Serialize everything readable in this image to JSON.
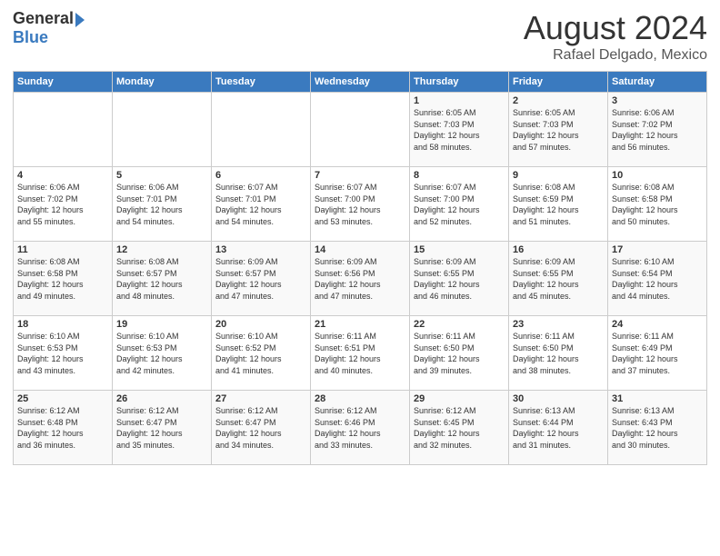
{
  "header": {
    "logo_general": "General",
    "logo_blue": "Blue",
    "month_title": "August 2024",
    "subtitle": "Rafael Delgado, Mexico"
  },
  "weekdays": [
    "Sunday",
    "Monday",
    "Tuesday",
    "Wednesday",
    "Thursday",
    "Friday",
    "Saturday"
  ],
  "weeks": [
    [
      {
        "day": "",
        "info": ""
      },
      {
        "day": "",
        "info": ""
      },
      {
        "day": "",
        "info": ""
      },
      {
        "day": "",
        "info": ""
      },
      {
        "day": "1",
        "info": "Sunrise: 6:05 AM\nSunset: 7:03 PM\nDaylight: 12 hours\nand 58 minutes."
      },
      {
        "day": "2",
        "info": "Sunrise: 6:05 AM\nSunset: 7:03 PM\nDaylight: 12 hours\nand 57 minutes."
      },
      {
        "day": "3",
        "info": "Sunrise: 6:06 AM\nSunset: 7:02 PM\nDaylight: 12 hours\nand 56 minutes."
      }
    ],
    [
      {
        "day": "4",
        "info": "Sunrise: 6:06 AM\nSunset: 7:02 PM\nDaylight: 12 hours\nand 55 minutes."
      },
      {
        "day": "5",
        "info": "Sunrise: 6:06 AM\nSunset: 7:01 PM\nDaylight: 12 hours\nand 54 minutes."
      },
      {
        "day": "6",
        "info": "Sunrise: 6:07 AM\nSunset: 7:01 PM\nDaylight: 12 hours\nand 54 minutes."
      },
      {
        "day": "7",
        "info": "Sunrise: 6:07 AM\nSunset: 7:00 PM\nDaylight: 12 hours\nand 53 minutes."
      },
      {
        "day": "8",
        "info": "Sunrise: 6:07 AM\nSunset: 7:00 PM\nDaylight: 12 hours\nand 52 minutes."
      },
      {
        "day": "9",
        "info": "Sunrise: 6:08 AM\nSunset: 6:59 PM\nDaylight: 12 hours\nand 51 minutes."
      },
      {
        "day": "10",
        "info": "Sunrise: 6:08 AM\nSunset: 6:58 PM\nDaylight: 12 hours\nand 50 minutes."
      }
    ],
    [
      {
        "day": "11",
        "info": "Sunrise: 6:08 AM\nSunset: 6:58 PM\nDaylight: 12 hours\nand 49 minutes."
      },
      {
        "day": "12",
        "info": "Sunrise: 6:08 AM\nSunset: 6:57 PM\nDaylight: 12 hours\nand 48 minutes."
      },
      {
        "day": "13",
        "info": "Sunrise: 6:09 AM\nSunset: 6:57 PM\nDaylight: 12 hours\nand 47 minutes."
      },
      {
        "day": "14",
        "info": "Sunrise: 6:09 AM\nSunset: 6:56 PM\nDaylight: 12 hours\nand 47 minutes."
      },
      {
        "day": "15",
        "info": "Sunrise: 6:09 AM\nSunset: 6:55 PM\nDaylight: 12 hours\nand 46 minutes."
      },
      {
        "day": "16",
        "info": "Sunrise: 6:09 AM\nSunset: 6:55 PM\nDaylight: 12 hours\nand 45 minutes."
      },
      {
        "day": "17",
        "info": "Sunrise: 6:10 AM\nSunset: 6:54 PM\nDaylight: 12 hours\nand 44 minutes."
      }
    ],
    [
      {
        "day": "18",
        "info": "Sunrise: 6:10 AM\nSunset: 6:53 PM\nDaylight: 12 hours\nand 43 minutes."
      },
      {
        "day": "19",
        "info": "Sunrise: 6:10 AM\nSunset: 6:53 PM\nDaylight: 12 hours\nand 42 minutes."
      },
      {
        "day": "20",
        "info": "Sunrise: 6:10 AM\nSunset: 6:52 PM\nDaylight: 12 hours\nand 41 minutes."
      },
      {
        "day": "21",
        "info": "Sunrise: 6:11 AM\nSunset: 6:51 PM\nDaylight: 12 hours\nand 40 minutes."
      },
      {
        "day": "22",
        "info": "Sunrise: 6:11 AM\nSunset: 6:50 PM\nDaylight: 12 hours\nand 39 minutes."
      },
      {
        "day": "23",
        "info": "Sunrise: 6:11 AM\nSunset: 6:50 PM\nDaylight: 12 hours\nand 38 minutes."
      },
      {
        "day": "24",
        "info": "Sunrise: 6:11 AM\nSunset: 6:49 PM\nDaylight: 12 hours\nand 37 minutes."
      }
    ],
    [
      {
        "day": "25",
        "info": "Sunrise: 6:12 AM\nSunset: 6:48 PM\nDaylight: 12 hours\nand 36 minutes."
      },
      {
        "day": "26",
        "info": "Sunrise: 6:12 AM\nSunset: 6:47 PM\nDaylight: 12 hours\nand 35 minutes."
      },
      {
        "day": "27",
        "info": "Sunrise: 6:12 AM\nSunset: 6:47 PM\nDaylight: 12 hours\nand 34 minutes."
      },
      {
        "day": "28",
        "info": "Sunrise: 6:12 AM\nSunset: 6:46 PM\nDaylight: 12 hours\nand 33 minutes."
      },
      {
        "day": "29",
        "info": "Sunrise: 6:12 AM\nSunset: 6:45 PM\nDaylight: 12 hours\nand 32 minutes."
      },
      {
        "day": "30",
        "info": "Sunrise: 6:13 AM\nSunset: 6:44 PM\nDaylight: 12 hours\nand 31 minutes."
      },
      {
        "day": "31",
        "info": "Sunrise: 6:13 AM\nSunset: 6:43 PM\nDaylight: 12 hours\nand 30 minutes."
      }
    ]
  ]
}
